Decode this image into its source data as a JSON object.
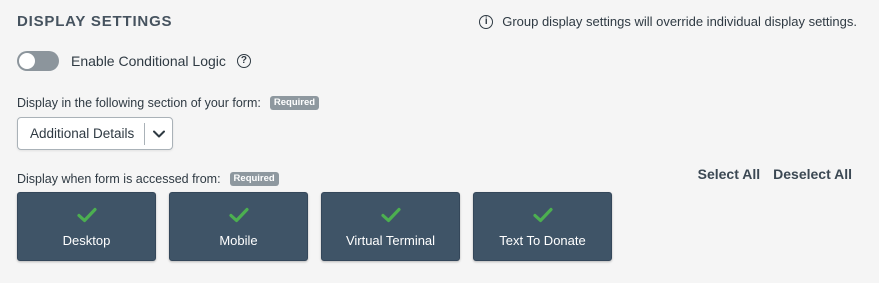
{
  "section": {
    "title": "DISPLAY SETTINGS",
    "notice": "Group display settings will override individual display settings."
  },
  "conditional_logic": {
    "label": "Enable Conditional Logic",
    "enabled": false
  },
  "form_section": {
    "label": "Display in the following section of your form:",
    "required_badge": "Required",
    "selected": "Additional Details"
  },
  "access": {
    "label": "Display when form is accessed from:",
    "required_badge": "Required",
    "select_all": "Select All",
    "deselect_all": "Deselect All",
    "options": [
      {
        "label": "Desktop",
        "checked": true
      },
      {
        "label": "Mobile",
        "checked": true
      },
      {
        "label": "Virtual Terminal",
        "checked": true
      },
      {
        "label": "Text To Donate",
        "checked": true
      }
    ]
  },
  "colors": {
    "tile_bg": "#3f5467",
    "check": "#4caf50",
    "badge_bg": "#8e989f",
    "toggle_off": "#8c959c"
  }
}
